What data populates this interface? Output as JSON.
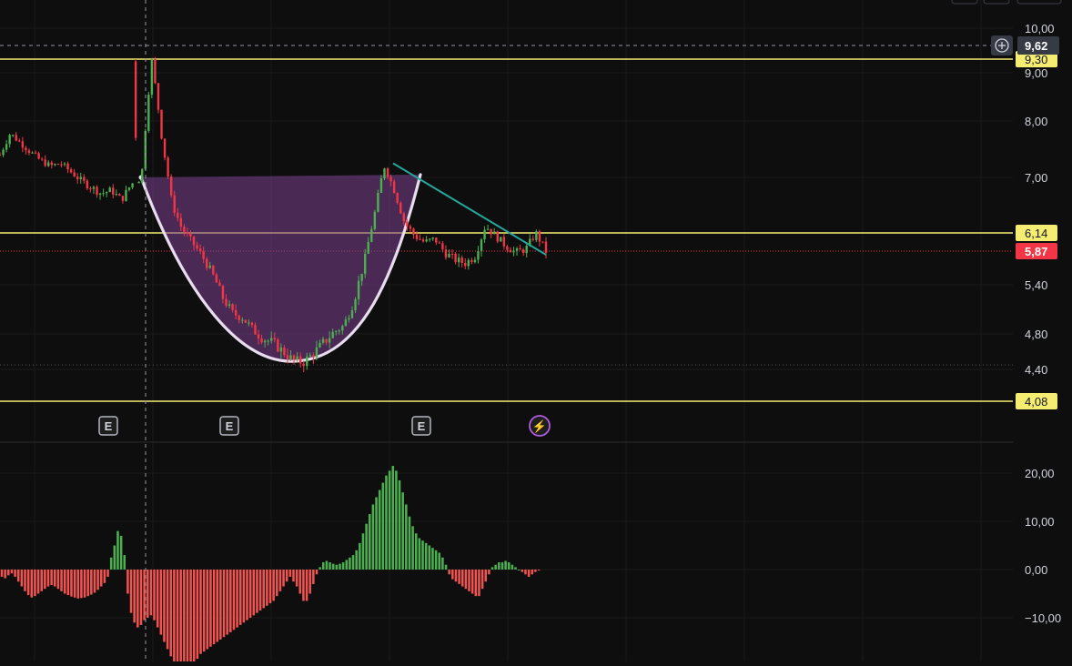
{
  "chart_data": [
    {
      "type": "candlestick",
      "panel": "price",
      "y_axis_ticks": [
        "10,00",
        "9,00",
        "8,00",
        "7,00",
        "5,40",
        "4,80",
        "4,40"
      ],
      "y_axis_tick_values": [
        10.0,
        9.0,
        8.0,
        7.0,
        5.4,
        4.8,
        4.4
      ],
      "crosshair_price": {
        "label": "9,62",
        "value": 9.62
      },
      "horizontal_levels": [
        {
          "label": "9,30",
          "value": 9.3,
          "color": "#f5ec72"
        },
        {
          "label": "6,14",
          "value": 6.14,
          "color": "#f5ec72"
        },
        {
          "label": "4,08",
          "value": 4.08,
          "color": "#f5ec72"
        }
      ],
      "last_price": {
        "label": "5,87",
        "value": 5.87,
        "color": "#f23645"
      },
      "dotted_level": 4.45,
      "pattern": {
        "name": "cup",
        "left_rim": 7.0,
        "bottom": 4.45,
        "right_rim": 7.05,
        "fill_color": "#7b3f8f"
      },
      "trendline": {
        "from": 7.25,
        "to": 5.87,
        "color": "#26a69a"
      },
      "price_path": [
        7.4,
        7.78,
        7.62,
        7.45,
        7.3,
        7.2,
        7.25,
        7.1,
        6.95,
        6.85,
        6.75,
        6.8,
        6.65,
        6.9,
        7.0,
        9.3,
        7.7,
        6.6,
        6.2,
        6.0,
        5.8,
        5.55,
        5.25,
        5.05,
        5.0,
        4.85,
        4.75,
        4.7,
        4.6,
        4.5,
        4.48,
        4.58,
        4.7,
        4.82,
        4.9,
        5.2,
        5.7,
        6.4,
        7.2,
        6.8,
        6.3,
        6.1,
        6.0,
        6.05,
        5.85,
        5.75,
        5.7,
        5.8,
        6.25,
        6.1,
        5.95,
        5.85,
        5.9,
        6.14,
        5.87
      ],
      "event_markers": [
        {
          "label": "E",
          "type": "earnings"
        },
        {
          "label": "E",
          "type": "earnings"
        },
        {
          "label": "E",
          "type": "earnings"
        },
        {
          "label": "⚡",
          "type": "flash"
        }
      ],
      "colors": {
        "up": "#4caf50",
        "down": "#f23645"
      }
    },
    {
      "type": "histogram",
      "panel": "oscillator",
      "y_axis_ticks": [
        "20,00",
        "10,00",
        "0,00",
        "−10,00"
      ],
      "y_axis_tick_values": [
        20,
        10,
        0,
        -10
      ],
      "values": [
        -1.5,
        -1.8,
        -1.2,
        -0.8,
        -1.5,
        -2.5,
        -3.5,
        -4.5,
        -5.3,
        -5.8,
        -5.5,
        -5.0,
        -4.5,
        -4.0,
        -3.5,
        -3.2,
        -3.5,
        -4.0,
        -4.5,
        -5.0,
        -5.3,
        -5.6,
        -5.8,
        -6.0,
        -5.9,
        -5.8,
        -5.5,
        -5.2,
        -4.8,
        -4.2,
        -3.5,
        -2.8,
        -1.5,
        2.5,
        5.0,
        8.0,
        7.0,
        3.0,
        -5.0,
        -9.0,
        -11.0,
        -12.0,
        -11.5,
        -10.5,
        -10.0,
        -9.5,
        -10.5,
        -12.0,
        -13.5,
        -15.0,
        -16.5,
        -18.0,
        -19.5,
        -20.5,
        -21.5,
        -22.0,
        -21.5,
        -20.5,
        -19.5,
        -18.5,
        -17.5,
        -17.0,
        -16.5,
        -16.0,
        -15.5,
        -15.0,
        -14.5,
        -14.0,
        -13.5,
        -13.0,
        -12.5,
        -12.0,
        -11.5,
        -11.0,
        -10.5,
        -10.0,
        -9.5,
        -9.0,
        -8.5,
        -8.0,
        -7.5,
        -7.0,
        -6.5,
        -5.5,
        -4.5,
        -3.5,
        -2.5,
        -1.5,
        -2.5,
        -3.5,
        -5.0,
        -6.5,
        -6.5,
        -5.0,
        -3.0,
        -1.0,
        0.5,
        1.5,
        1.8,
        1.5,
        1.2,
        1.0,
        1.2,
        1.5,
        2.0,
        2.5,
        3.0,
        4.0,
        5.5,
        7.5,
        9.5,
        11.5,
        13.5,
        15.0,
        16.5,
        18.0,
        19.5,
        20.5,
        21.5,
        20.5,
        18.5,
        16.0,
        13.5,
        11.0,
        9.0,
        7.5,
        6.5,
        6.0,
        5.5,
        5.0,
        4.5,
        4.0,
        3.5,
        2.5,
        1.0,
        -1.0,
        -2.0,
        -2.5,
        -3.0,
        -3.5,
        -4.0,
        -4.5,
        -5.0,
        -5.5,
        -5.5,
        -4.0,
        -2.5,
        -1.0,
        0.5,
        1.0,
        1.5,
        1.5,
        1.8,
        1.5,
        1.0,
        0.5,
        0.0,
        -0.5,
        -1.0,
        -1.5,
        -1.0,
        -0.5,
        -0.2
      ],
      "colors": {
        "positive": "#4caf50",
        "negative": "#f05350"
      }
    }
  ]
}
